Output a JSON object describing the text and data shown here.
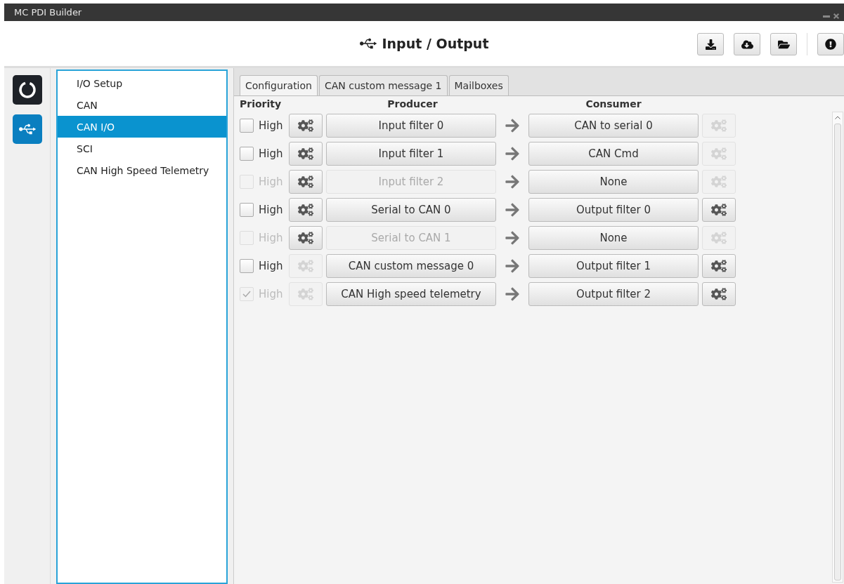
{
  "window": {
    "title": "MC PDI Builder"
  },
  "header": {
    "title": "Input / Output"
  },
  "rail": [
    {
      "kind": "power",
      "selected": false
    },
    {
      "kind": "usb",
      "selected": true
    }
  ],
  "sidebar": {
    "items": [
      {
        "label": "I/O Setup",
        "selected": false
      },
      {
        "label": "CAN",
        "selected": false
      },
      {
        "label": "CAN I/O",
        "selected": true
      },
      {
        "label": "SCI",
        "selected": false
      },
      {
        "label": "CAN High Speed Telemetry",
        "selected": false
      }
    ]
  },
  "tabs": [
    {
      "label": "Configuration",
      "selected": true
    },
    {
      "label": "CAN custom message 1",
      "selected": false
    },
    {
      "label": "Mailboxes",
      "selected": false
    }
  ],
  "columns": {
    "priority": "Priority",
    "producer": "Producer",
    "consumer": "Consumer"
  },
  "rows": [
    {
      "priority_label": "High",
      "checked": false,
      "priority_disabled": false,
      "producer_gear_disabled": false,
      "producer": "Input filter 0",
      "producer_disabled": false,
      "consumer": "CAN to serial 0",
      "consumer_gear_disabled": true
    },
    {
      "priority_label": "High",
      "checked": false,
      "priority_disabled": false,
      "producer_gear_disabled": false,
      "producer": "Input filter 1",
      "producer_disabled": false,
      "consumer": "CAN Cmd",
      "consumer_gear_disabled": true
    },
    {
      "priority_label": "High",
      "checked": false,
      "priority_disabled": true,
      "producer_gear_disabled": false,
      "producer": "Input filter 2",
      "producer_disabled": true,
      "consumer": "None",
      "consumer_gear_disabled": true
    },
    {
      "priority_label": "High",
      "checked": false,
      "priority_disabled": false,
      "producer_gear_disabled": false,
      "producer": "Serial to CAN 0",
      "producer_disabled": false,
      "consumer": "Output filter 0",
      "consumer_gear_disabled": false
    },
    {
      "priority_label": "High",
      "checked": false,
      "priority_disabled": true,
      "producer_gear_disabled": false,
      "producer": "Serial to CAN 1",
      "producer_disabled": true,
      "consumer": "None",
      "consumer_gear_disabled": true
    },
    {
      "priority_label": "High",
      "checked": false,
      "priority_disabled": false,
      "producer_gear_disabled": true,
      "producer": "CAN custom message 0",
      "producer_disabled": false,
      "consumer": "Output filter 1",
      "consumer_gear_disabled": false
    },
    {
      "priority_label": "High",
      "checked": true,
      "priority_disabled": true,
      "producer_gear_disabled": true,
      "producer": "CAN High speed telemetry",
      "producer_disabled": false,
      "consumer": "Output filter 2",
      "consumer_gear_disabled": false
    }
  ]
}
